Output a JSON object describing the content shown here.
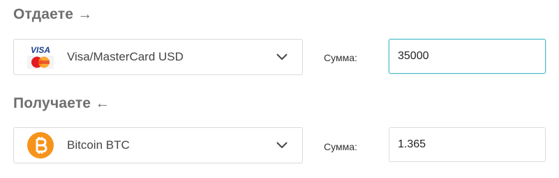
{
  "give": {
    "title": "Отдаете",
    "arrow": "→",
    "currency": {
      "label": "Visa/MasterCard USD",
      "icon": "visa-mastercard-logo",
      "visa_text": "VISA"
    },
    "sum_label": "Сумма:",
    "amount": "35000"
  },
  "receive": {
    "title": "Получаете",
    "arrow": "←",
    "currency": {
      "label": "Bitcoin BTC",
      "icon": "bitcoin-logo",
      "brand_color": "#f7931a"
    },
    "sum_label": "Сумма:",
    "amount": "1.365"
  },
  "colors": {
    "focus_border": "#4dbcc9",
    "title_gray": "#6e6e6e"
  }
}
